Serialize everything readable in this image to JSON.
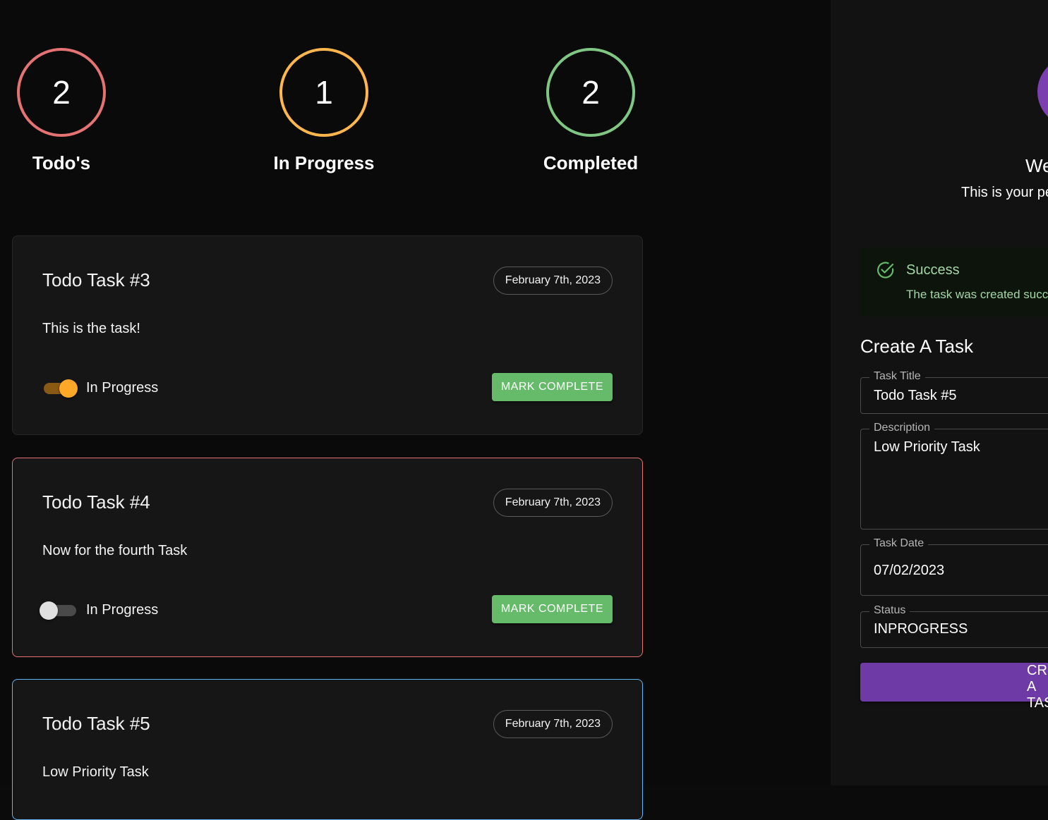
{
  "stats": [
    {
      "count": "2",
      "label": "Todo's",
      "color": "#e57373"
    },
    {
      "count": "1",
      "label": "In Progress",
      "color": "#ffb74d"
    },
    {
      "count": "2",
      "label": "Completed",
      "color": "#81c784"
    }
  ],
  "tasks": [
    {
      "title": "Todo Task #3",
      "date": "February 7th, 2023",
      "description": "This is the task!",
      "toggle_label": "In Progress",
      "in_progress": true,
      "button_label": "MARK COMPLETE"
    },
    {
      "title": "Todo Task #4",
      "date": "February 7th, 2023",
      "description": "Now for the fourth Task",
      "toggle_label": "In Progress",
      "in_progress": false,
      "button_label": "MARK COMPLETE",
      "border_color": "#e57373"
    },
    {
      "title": "Todo Task #5",
      "date": "February 7th, 2023",
      "description": "Low Priority Task",
      "border_color": "#64b5f6"
    }
  ],
  "sidebar": {
    "welcome": "Welcome",
    "subtitle": "This is your personal task manager",
    "alert": {
      "title": "Success",
      "message": "The task was created successfully"
    },
    "form": {
      "title": "Create A Task",
      "task_title": {
        "label": "Task Title",
        "value": "Todo Task #5"
      },
      "description": {
        "label": "Description",
        "value": "Low Priority Task"
      },
      "task_date": {
        "label": "Task Date",
        "value": "07/02/2023"
      },
      "status": {
        "label": "Status",
        "value": "INPROGRESS"
      },
      "submit_label": "CREATE A TASK"
    }
  },
  "colors": {
    "accent": "#6d3aa6",
    "success": "#66bb6a",
    "warning": "#ffa726"
  }
}
